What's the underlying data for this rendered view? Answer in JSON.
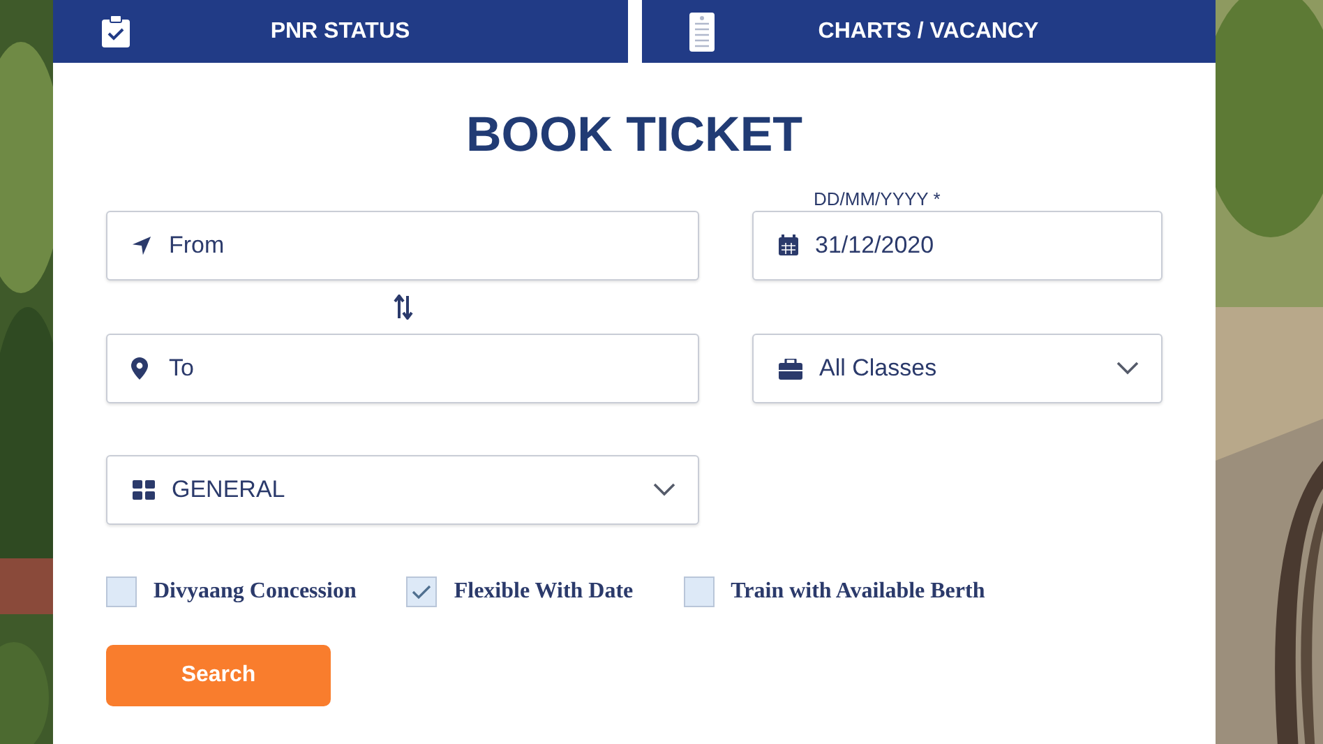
{
  "tabs": [
    {
      "label": "PNR STATUS"
    },
    {
      "label": "CHARTS / VACANCY"
    }
  ],
  "title": "BOOK TICKET",
  "from_field": {
    "placeholder": "From"
  },
  "to_field": {
    "placeholder": "To"
  },
  "date_field": {
    "label": "DD/MM/YYYY *",
    "value": "31/12/2020"
  },
  "class_select": {
    "value": "All Classes"
  },
  "quota_select": {
    "value": "GENERAL"
  },
  "options": [
    {
      "label": "Divyaang Concession",
      "checked": false
    },
    {
      "label": "Flexible With Date",
      "checked": true
    },
    {
      "label": "Train with Available Berth",
      "checked": false
    }
  ],
  "search_button": "Search"
}
